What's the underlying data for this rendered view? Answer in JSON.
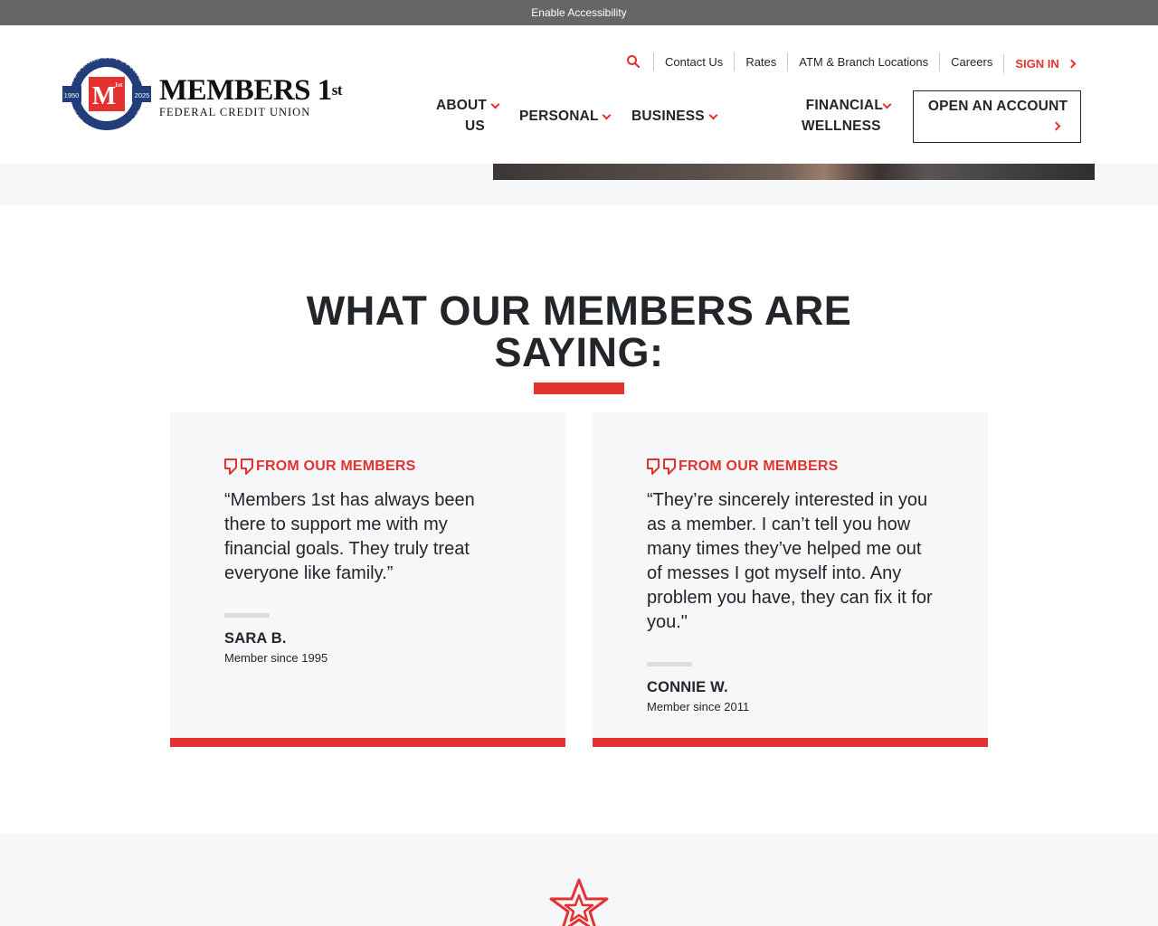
{
  "accessibility": {
    "label": "Enable Accessibility"
  },
  "brand": {
    "name": "MEMBERS 1",
    "name_superscript": "st",
    "subtitle": "FEDERAL CREDIT UNION",
    "seal_top_text": "75 YEARS OF PUTTING",
    "seal_bottom_text": "OUR MEMBERS FIRST",
    "seal_year_left": "1950",
    "seal_year_right": "2025",
    "seal_monogram": "M",
    "seal_monogram_sup": "1st",
    "colors": {
      "red": "#e3322f",
      "navy": "#213e7a"
    }
  },
  "utility_nav": {
    "search_icon": "search-icon",
    "items": [
      "Contact Us",
      "Rates",
      "ATM & Branch Locations",
      "Careers"
    ],
    "sign_in": "SIGN IN"
  },
  "main_nav": {
    "about_line1": "ABOUT",
    "about_line2": "US",
    "personal": "PERSONAL",
    "business": "BUSINESS",
    "financial_line1": "FINANCIAL",
    "financial_line2": "WELLNESS",
    "open_account": "OPEN AN ACCOUNT"
  },
  "testimonials": {
    "title_line1": "WHAT OUR MEMBERS ARE",
    "title_line2": "SAYING:",
    "cards": [
      {
        "kicker": "FROM OUR MEMBERS",
        "quote": "“Members 1st has always been there to support me with my financial goals. They truly treat everyone like family.”",
        "author": "SARA B.",
        "since": "Member since 1995"
      },
      {
        "kicker": "FROM OUR MEMBERS",
        "quote": "“They’re sincerely interested in you as a member. I can’t tell you how many times they’ve helped me out of messes I got myself into. Any problem you have, they can fix it for you.\"",
        "author": "CONNIE W.",
        "since": "Member since 2011"
      }
    ]
  },
  "bottom_section": {
    "icon": "star-icon"
  }
}
